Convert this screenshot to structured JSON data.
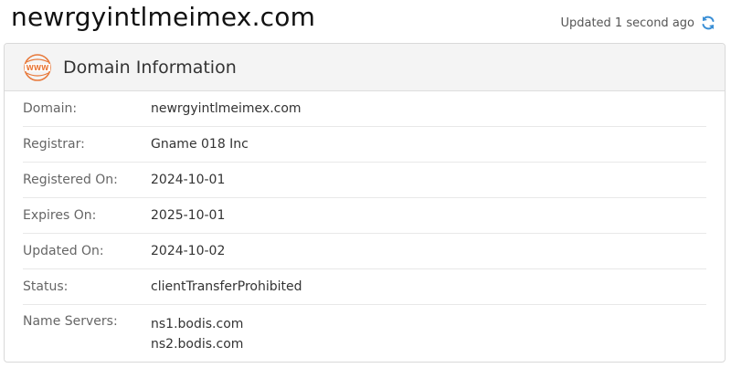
{
  "page": {
    "title": "newrgyintlmeimex.com",
    "updated_text": "Updated 1 second ago"
  },
  "colors": {
    "accent": "#e8793b",
    "refresh": "#3a8fd6"
  },
  "icons": {
    "header": "www-globe-icon",
    "refresh": "refresh-icon"
  },
  "card": {
    "title": "Domain Information",
    "rows": [
      {
        "label": "Domain:",
        "value": "newrgyintlmeimex.com"
      },
      {
        "label": "Registrar:",
        "value": "Gname 018 Inc"
      },
      {
        "label": "Registered On:",
        "value": "2024-10-01"
      },
      {
        "label": "Expires On:",
        "value": "2025-10-01"
      },
      {
        "label": "Updated On:",
        "value": "2024-10-02"
      },
      {
        "label": "Status:",
        "value": "clientTransferProhibited"
      }
    ],
    "name_servers": {
      "label": "Name Servers:",
      "values": [
        "ns1.bodis.com",
        "ns2.bodis.com"
      ]
    }
  }
}
